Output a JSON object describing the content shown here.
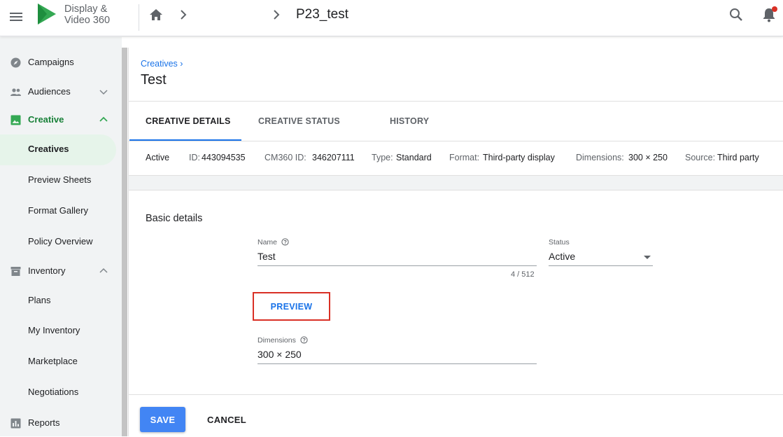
{
  "app": {
    "name_line1": "Display &",
    "name_line2": "Video 360",
    "brand_color": "#34a853"
  },
  "topbar": {
    "current": "P23_test"
  },
  "sidebar": {
    "campaigns": "Campaigns",
    "audiences": "Audiences",
    "creative": "Creative",
    "creatives": "Creatives",
    "preview_sheets": "Preview Sheets",
    "format_gallery": "Format Gallery",
    "policy_overview": "Policy Overview",
    "inventory": "Inventory",
    "plans": "Plans",
    "my_inventory": "My Inventory",
    "marketplace": "Marketplace",
    "negotiations": "Negotiations",
    "reports": "Reports"
  },
  "page": {
    "breadcrumb": "Creatives ›",
    "title": "Test",
    "tabs": [
      "CREATIVE DETAILS",
      "CREATIVE STATUS",
      "HISTORY"
    ],
    "active_tab": "CREATIVE DETAILS"
  },
  "info": {
    "status": "Active",
    "id_key": "ID:",
    "id_val": "443094535",
    "cm_key": "CM360 ID:",
    "cm_val": "346207111",
    "type_key": "Type:",
    "type_val": "Standard",
    "format_key": "Format:",
    "format_val": "Third-party display",
    "dim_key": "Dimensions:",
    "dim_val": "300 × 250",
    "source_key": "Source:",
    "source_val": "Third party"
  },
  "basic": {
    "section_title": "Basic details",
    "name_label": "Name",
    "name_value": "Test",
    "name_counter": "4 / 512",
    "status_label": "Status",
    "status_value": "Active",
    "preview_label": "PREVIEW",
    "dimensions_label": "Dimensions",
    "dimensions_value": "300 × 250"
  },
  "footer": {
    "save": "SAVE",
    "cancel": "CANCEL"
  }
}
